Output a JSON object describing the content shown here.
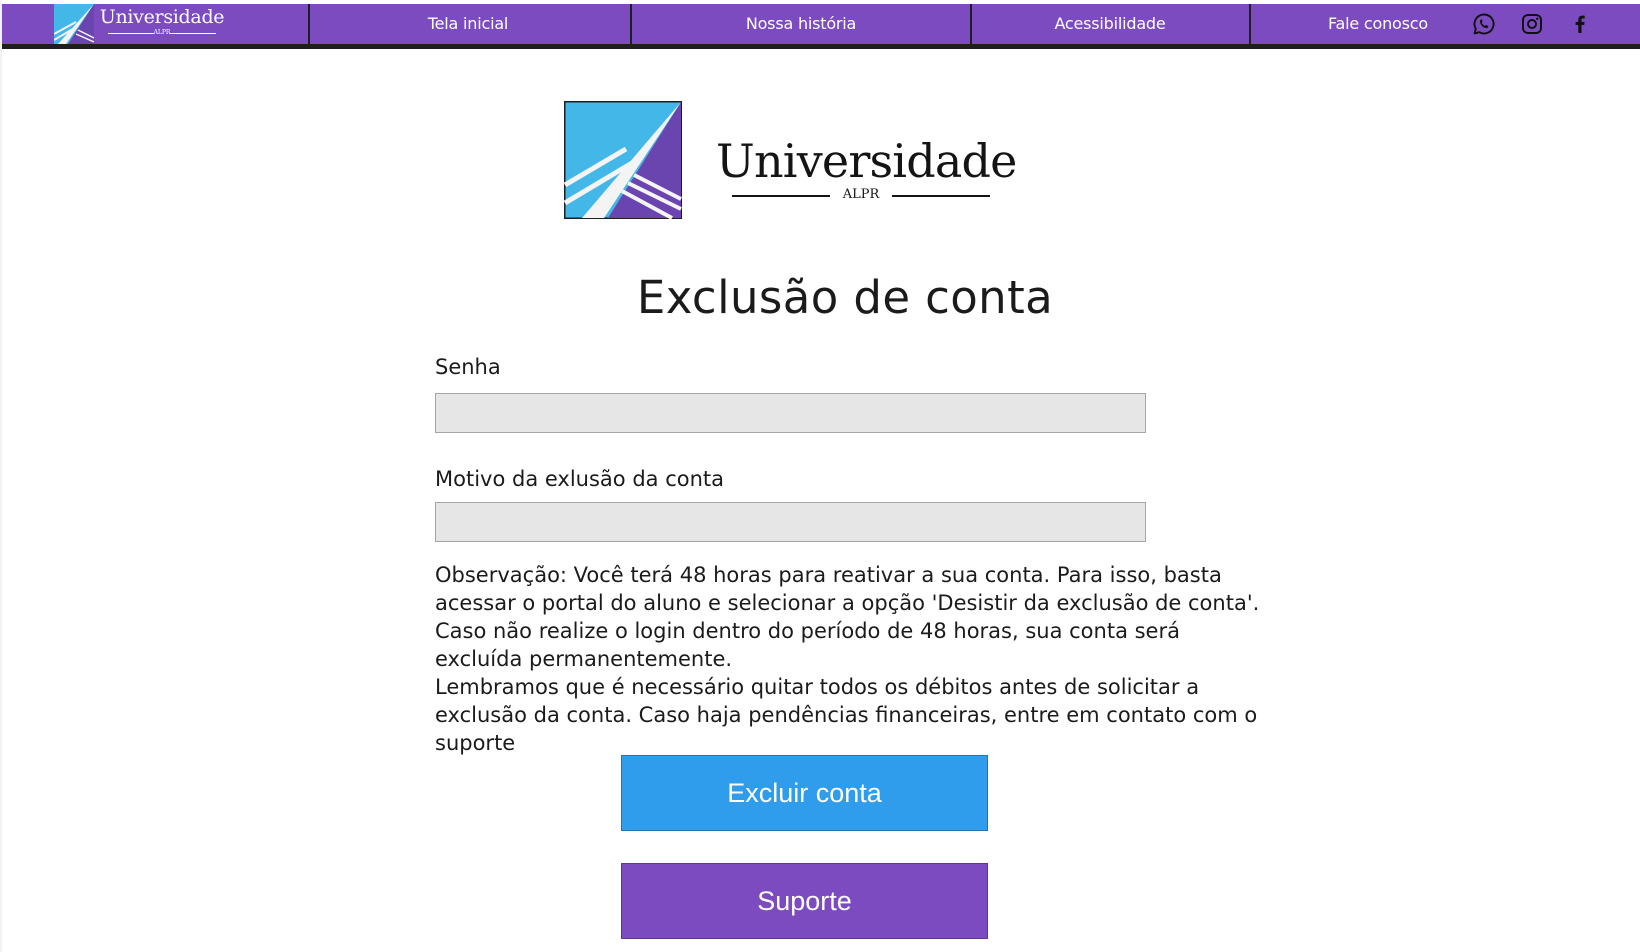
{
  "colors": {
    "brand_purple": "#7d4bc0",
    "accent_blue": "#2f9cec",
    "logo_light_blue": "#43b8e8",
    "input_bg": "#e6e6e6"
  },
  "header": {
    "logo": {
      "name": "Universidade",
      "sub": "ALPR"
    },
    "nav": [
      {
        "label": "Tela inicial"
      },
      {
        "label": "Nossa história"
      },
      {
        "label": "Acessibilidade"
      },
      {
        "label": "Fale conosco"
      }
    ],
    "social": [
      {
        "icon": "whatsapp-icon"
      },
      {
        "icon": "instagram-icon"
      },
      {
        "icon": "facebook-icon"
      }
    ]
  },
  "brand": {
    "name": "Universidade",
    "sub": "ALPR"
  },
  "form": {
    "title": "Exclusão de conta",
    "password_label": "Senha",
    "password_value": "",
    "reason_label": "Motivo da exlusão da conta",
    "reason_value": "",
    "note_paragraph_1": "Observação: Você terá 48 horas para reativar a sua conta. Para isso, basta acessar o portal do aluno e selecionar a opção 'Desistir da exclusão de conta'. Caso não realize o login dentro do período de 48 horas, sua conta será excluída permanentemente.",
    "note_paragraph_2": "Lembramos que é necessário quitar todos os débitos antes de solicitar a exclusão da conta. Caso haja pendências financeiras, entre em contato com o suporte",
    "delete_button": "Excluir conta",
    "support_button": "Suporte"
  }
}
